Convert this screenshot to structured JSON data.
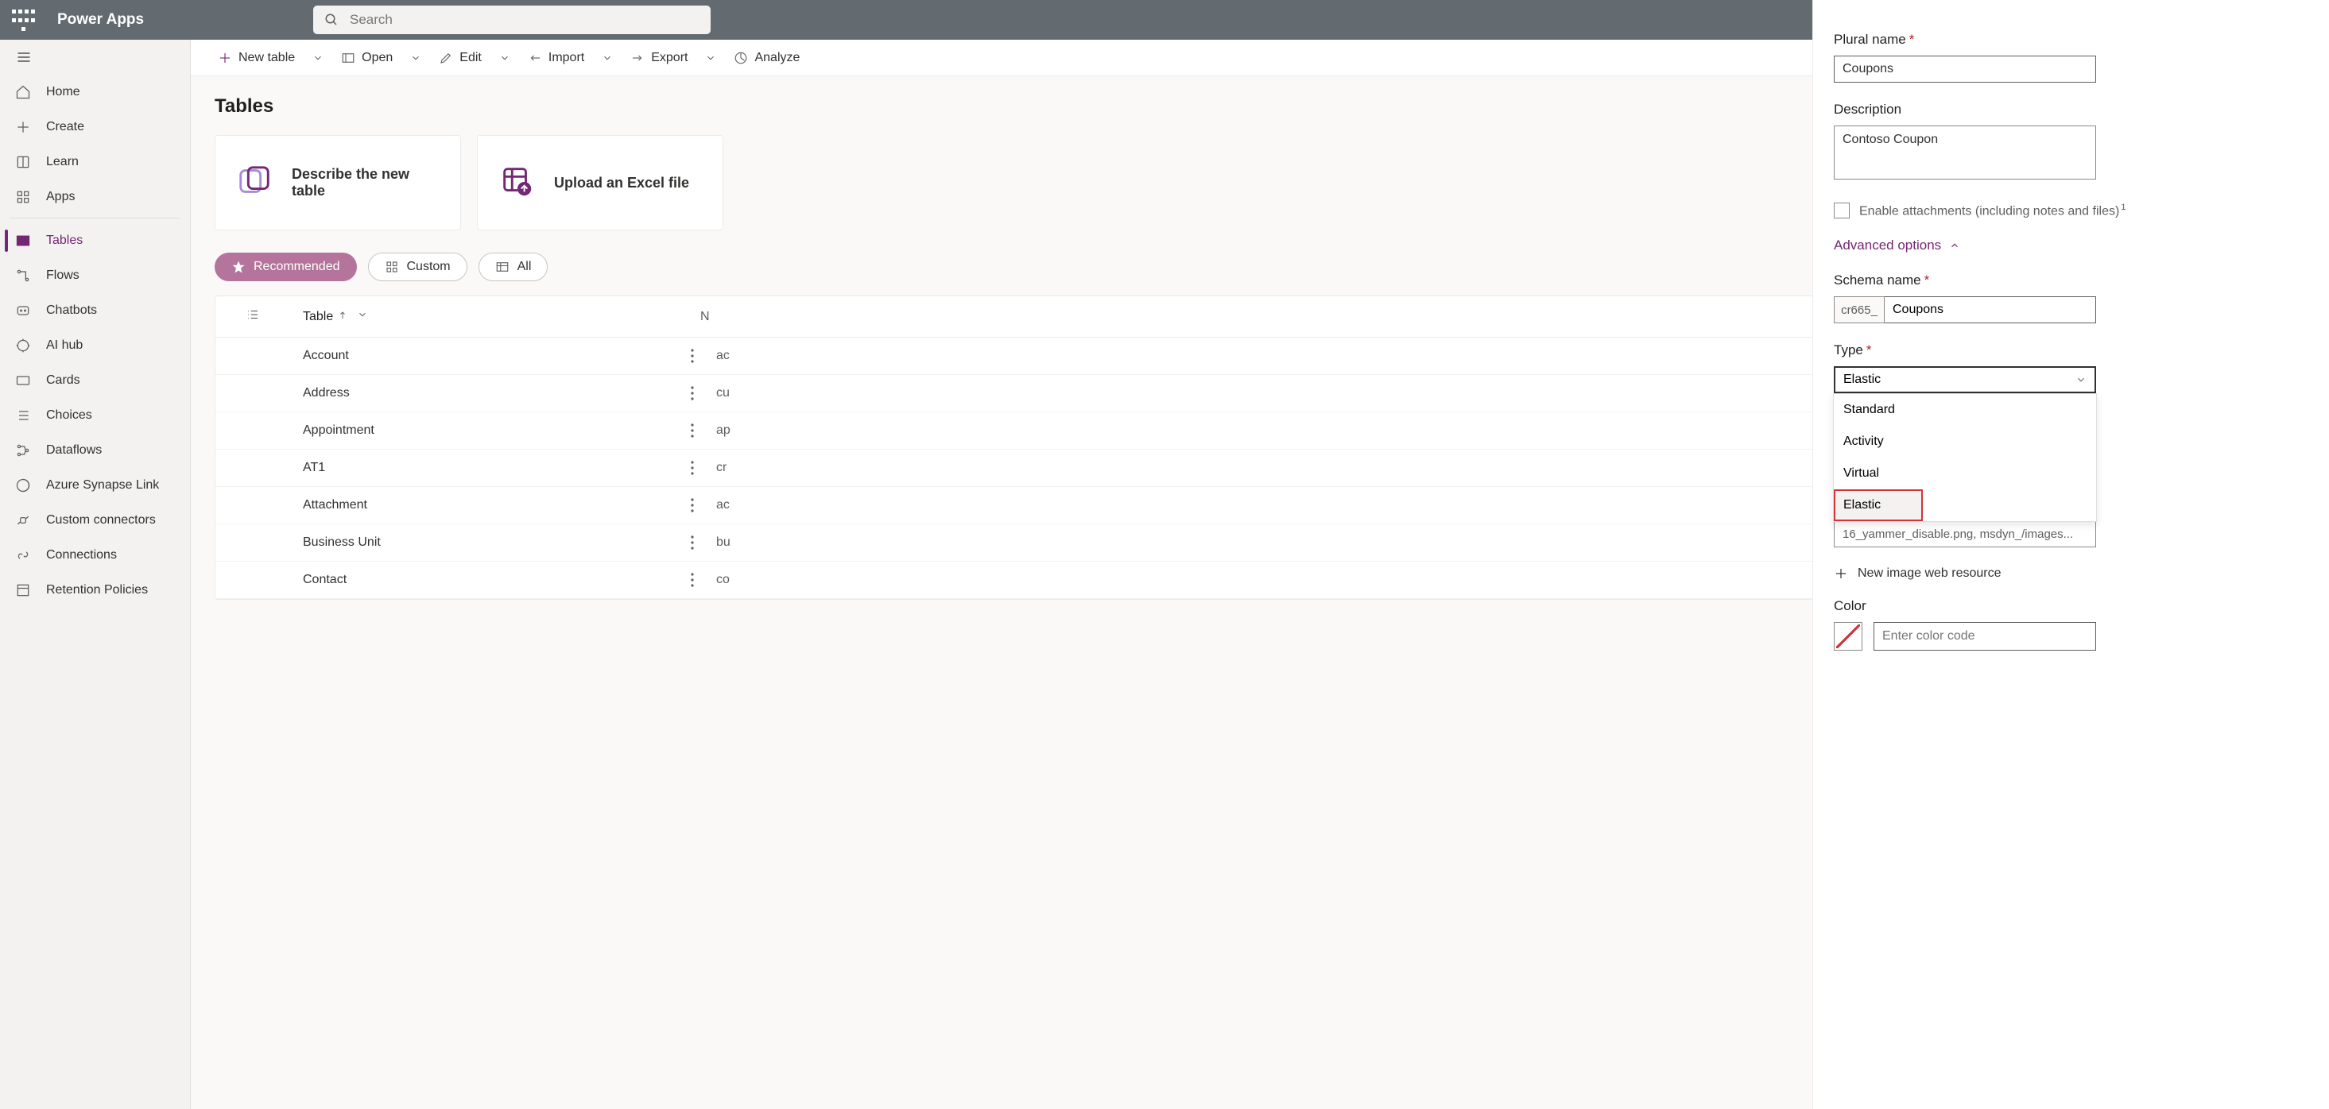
{
  "app_title": "Power Apps",
  "search_placeholder": "Search",
  "sidebar": {
    "items": [
      {
        "label": "Home"
      },
      {
        "label": "Create"
      },
      {
        "label": "Learn"
      },
      {
        "label": "Apps"
      },
      {
        "label": "Tables"
      },
      {
        "label": "Flows"
      },
      {
        "label": "Chatbots"
      },
      {
        "label": "AI hub"
      },
      {
        "label": "Cards"
      },
      {
        "label": "Choices"
      },
      {
        "label": "Dataflows"
      },
      {
        "label": "Azure Synapse Link"
      },
      {
        "label": "Custom connectors"
      },
      {
        "label": "Connections"
      },
      {
        "label": "Retention Policies"
      }
    ]
  },
  "cmd": {
    "new_table": "New table",
    "open": "Open",
    "edit": "Edit",
    "import": "Import",
    "export": "Export",
    "analyze": "Analyze"
  },
  "page_title": "Tables",
  "cards": {
    "describe": "Describe the new table",
    "upload": "Upload an Excel file"
  },
  "pills": {
    "recommended": "Recommended",
    "custom": "Custom",
    "all": "All"
  },
  "table": {
    "col_table": "Table",
    "col_n": "N",
    "rows": [
      {
        "name": "Account",
        "col2": "ac"
      },
      {
        "name": "Address",
        "col2": "cu"
      },
      {
        "name": "Appointment",
        "col2": "ap"
      },
      {
        "name": "AT1",
        "col2": "cr"
      },
      {
        "name": "Attachment",
        "col2": "ac"
      },
      {
        "name": "Business Unit",
        "col2": "bu"
      },
      {
        "name": "Contact",
        "col2": "co"
      }
    ]
  },
  "panel": {
    "plural_name_label": "Plural name",
    "plural_name_value": "Coupons",
    "description_label": "Description",
    "description_value": "Contoso Coupon",
    "enable_attachments": "Enable attachments (including notes and files)",
    "footnote": "1",
    "advanced": "Advanced options",
    "schema_label": "Schema name",
    "schema_prefix": "cr665_",
    "schema_value": "Coupons",
    "type_label": "Type",
    "type_value": "Elastic",
    "type_options": [
      "Standard",
      "Activity",
      "Virtual",
      "Elastic"
    ],
    "image_row_hint": "16_yammer_disable.png, msdyn_/images...",
    "new_image": "New image web resource",
    "color_label": "Color",
    "color_placeholder": "Enter color code"
  }
}
